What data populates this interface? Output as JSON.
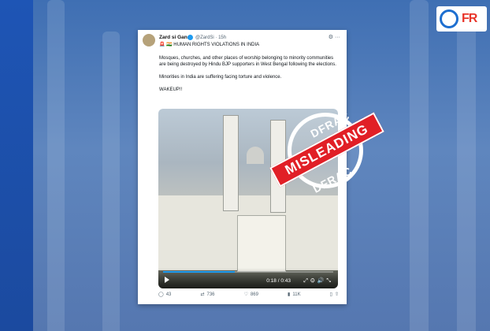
{
  "brand": {
    "logo_text": "FR"
  },
  "post": {
    "display_name": "Zard si Gana",
    "handle_time": "@ZardSi · 15h",
    "headline": "🚨 🇮🇳 HUMAN RIGHTS VIOLATIONS IN INDIA",
    "paragraphs": [
      "Mosques, churches, and other places of worship belonging to minority communities are being destroyed by Hindu BJP supporters in West Bengal following the elections.",
      "Minorities in India are suffering facing torture and violence.",
      "WAKEUP!!"
    ],
    "video": {
      "time": "0:18 / 0:43",
      "progress": 0.42
    },
    "actions": {
      "replies": "43",
      "reposts": "736",
      "likes": "869",
      "views": "11K"
    }
  },
  "stamp": {
    "ring_top": "DFRAC",
    "ring_bottom": "DFRAC",
    "banner": "MISLEADING"
  },
  "colors": {
    "stamp_red": "#e11f26",
    "twitter_blue": "#1d9bf0",
    "background": "#4f7ab8"
  }
}
